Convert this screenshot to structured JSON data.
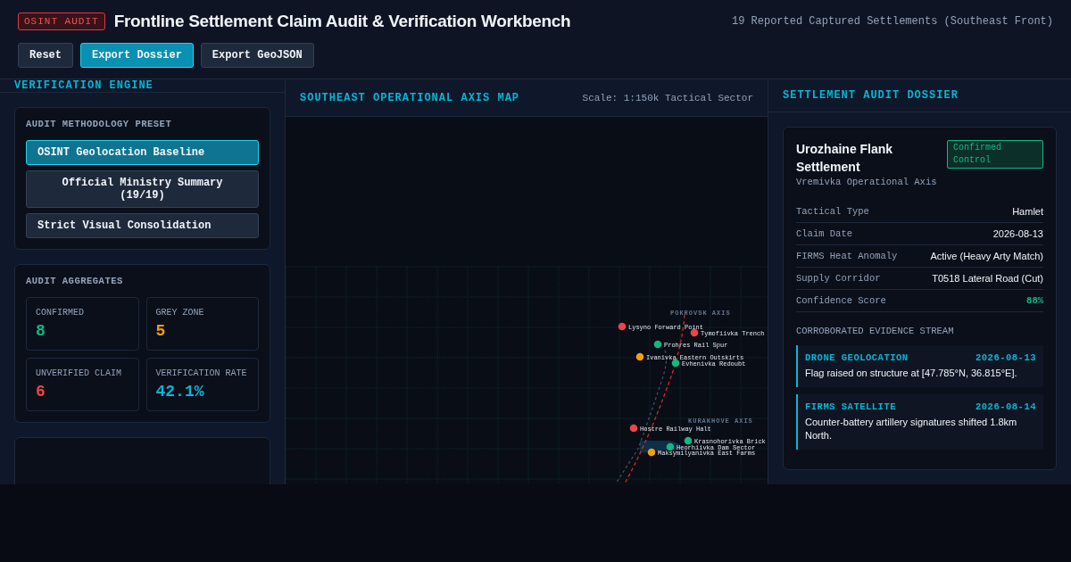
{
  "header": {
    "badge": "OSINT AUDIT",
    "title": "Frontline Settlement Claim Audit & Verification Workbench",
    "summary": "19 Reported Captured Settlements (Southeast Front)",
    "buttons": [
      {
        "label": "Reset",
        "primary": false
      },
      {
        "label": "Export Dossier",
        "primary": true
      },
      {
        "label": "Export GeoJSON",
        "primary": false
      }
    ]
  },
  "engine": {
    "title": "VERIFICATION ENGINE",
    "preset_title": "AUDIT METHODOLOGY PRESET",
    "presets": [
      {
        "label": "OSINT Geolocation Baseline",
        "selected": true
      },
      {
        "label": "Official Ministry Summary (19/19)",
        "selected": false
      },
      {
        "label": "Strict Visual Consolidation",
        "selected": false
      }
    ],
    "aggregates_title": "AUDIT AGGREGATES",
    "aggregates": [
      {
        "label": "CONFIRMED",
        "value": "8",
        "color": "#10b981"
      },
      {
        "label": "GREY ZONE",
        "value": "5",
        "color": "#f59e0b"
      },
      {
        "label": "UNVERIFIED CLAIM",
        "value": "6",
        "color": "#ef4444"
      },
      {
        "label": "VERIFICATION RATE",
        "value": "42.1%",
        "color": "#06b6d4"
      }
    ]
  },
  "map": {
    "title": "SOUTHEAST OPERATIONAL AXIS MAP",
    "scale": "Scale: 1:150k Tactical Sector",
    "axes": [
      "POKROVSK AXIS",
      "KURAKHOVE AXIS"
    ],
    "pins": [
      {
        "name": "Lysyno Forward Point",
        "color": "#ef4444"
      },
      {
        "name": "Tymofiivka Trench",
        "color": "#ef4444"
      },
      {
        "name": "Prohres Rail Spur",
        "color": "#10b981"
      },
      {
        "name": "Ivanivka Eastern Outskirts",
        "color": "#f59e0b"
      },
      {
        "name": "Evhenivka Redoubt",
        "color": "#10b981"
      },
      {
        "name": "Hostre Railway Halt",
        "color": "#ef4444"
      },
      {
        "name": "Krasnohorivka Brick",
        "color": "#10b981"
      },
      {
        "name": "Heorhiivka Dam Sector",
        "color": "#10b981"
      },
      {
        "name": "Maksymilyanivka East Farms",
        "color": "#f59e0b"
      }
    ]
  },
  "dossier": {
    "title": "SETTLEMENT AUDIT DOSSIER",
    "settlement": "Urozhaine Flank Settlement",
    "axis": "Vremivka Operational Axis",
    "status": "Confirmed Control",
    "fields": [
      {
        "label": "Tactical Type",
        "value": "Hamlet",
        "kind": "text"
      },
      {
        "label": "Claim Date",
        "value": "2026-08-13",
        "kind": "text"
      },
      {
        "label": "FIRMS Heat Anomaly",
        "value": "Active (Heavy Arty Match)",
        "kind": "text"
      },
      {
        "label": "Supply Corridor",
        "value": "T0518 Lateral Road (Cut)",
        "kind": "text"
      },
      {
        "label": "Confidence Score",
        "value": "88%",
        "kind": "score"
      }
    ],
    "evidence_title": "CORROBORATED EVIDENCE STREAM",
    "evidence": [
      {
        "source": "DRONE GEOLOCATION",
        "date": "2026-08-13",
        "text": "Flag raised on structure at [47.785°N, 36.815°E]."
      },
      {
        "source": "FIRMS SATELLITE",
        "date": "2026-08-14",
        "text": "Counter-battery artillery signatures shifted 1.8km North."
      }
    ]
  }
}
